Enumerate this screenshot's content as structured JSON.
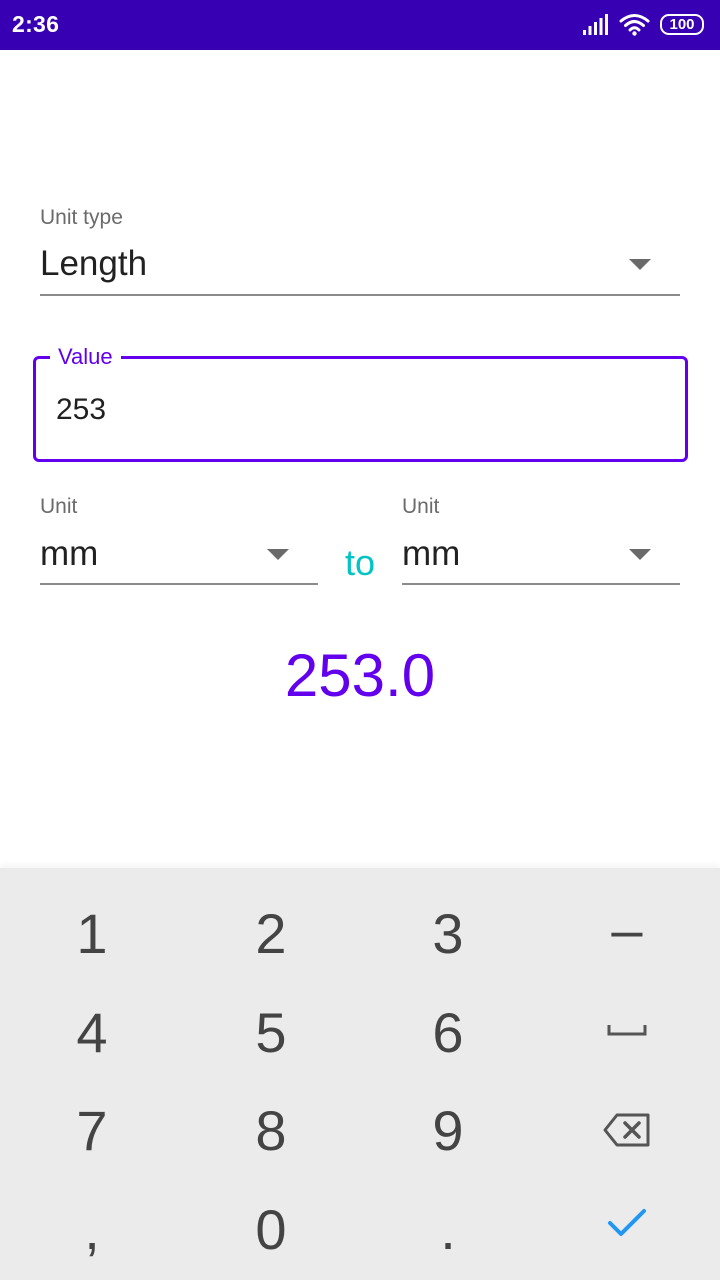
{
  "status_bar": {
    "time": "2:36",
    "battery": "100",
    "icons": [
      "signal-icon",
      "wifi-icon",
      "battery-icon"
    ]
  },
  "form": {
    "unit_type": {
      "label": "Unit type",
      "value": "Length"
    },
    "value_field": {
      "label": "Value",
      "value": "253"
    },
    "from_unit": {
      "label": "Unit",
      "value": "mm"
    },
    "connector": "to",
    "to_unit": {
      "label": "Unit",
      "value": "mm"
    },
    "result": "253.0"
  },
  "keyboard": {
    "rows": [
      [
        "1",
        "2",
        "3",
        "–"
      ],
      [
        "4",
        "5",
        "6",
        "space-icon"
      ],
      [
        "7",
        "8",
        "9",
        "backspace-icon"
      ],
      [
        ",",
        "0",
        ".",
        "check-icon"
      ]
    ]
  },
  "colors": {
    "status_bar": "#3700b3",
    "primary": "#6200ee",
    "accent": "#03c4c4",
    "keyboard_bg": "#ebebeb",
    "key_text": "#444444",
    "check": "#2196f3"
  }
}
